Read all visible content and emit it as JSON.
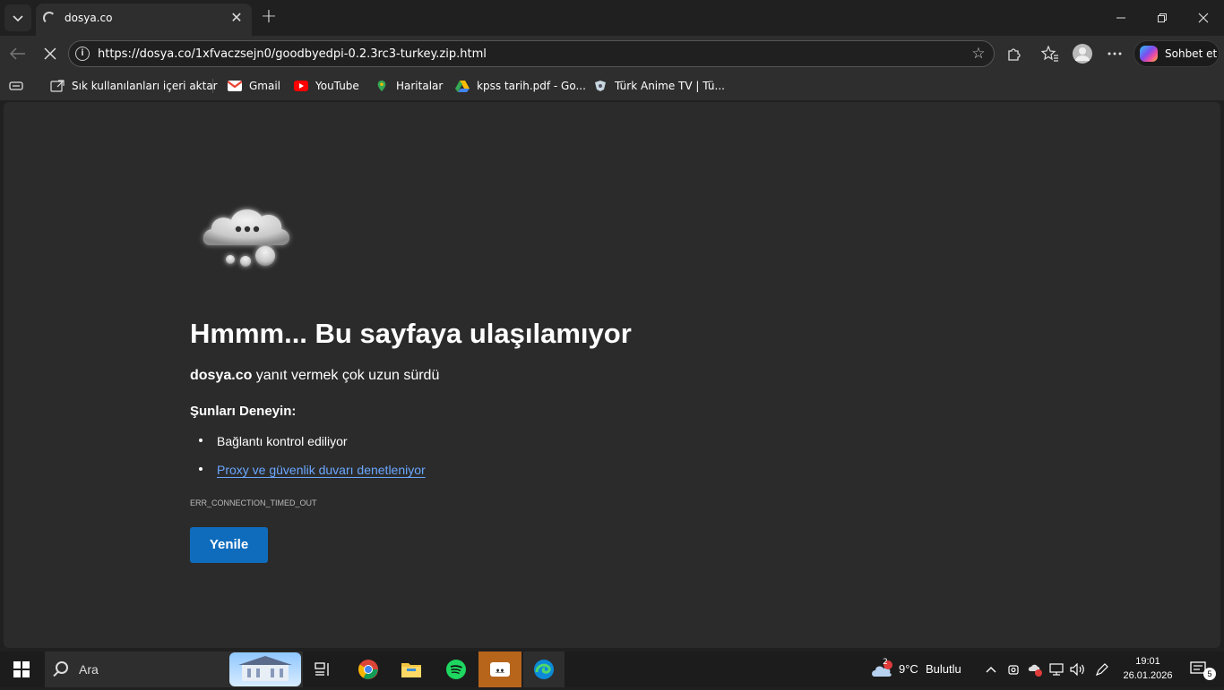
{
  "tab": {
    "title": "dosya.co",
    "close_glyph": "✕"
  },
  "new_tab_glyph": "+",
  "window": {
    "minimize": "—",
    "maximize": "⧉",
    "close": "✕"
  },
  "address": {
    "url": "https://dosya.co/1xfvaczsejn0/goodbyedpi-0.2.3rc3-turkey.zip.html",
    "info_glyph": "i"
  },
  "copilot": {
    "label": "Sohbet et"
  },
  "bookmarks": [
    {
      "label": "Sık kullanılanları içeri aktar",
      "icon": "import-icon"
    },
    {
      "label": "Gmail",
      "icon": "gmail-icon"
    },
    {
      "label": "YouTube",
      "icon": "youtube-icon"
    },
    {
      "label": "Haritalar",
      "icon": "maps-icon"
    },
    {
      "label": "kpss tarih.pdf - Go...",
      "icon": "drive-icon"
    },
    {
      "label": "Türk Anime TV | Tü...",
      "icon": "turkanime-icon"
    }
  ],
  "error": {
    "title": "Hmmm... Bu sayfaya ulaşılamıyor",
    "host": "dosya.co",
    "message": " yanıt vermek çok uzun sürdü",
    "try_heading": "Şunları Deneyin:",
    "suggestions": [
      {
        "text": "Bağlantı kontrol ediliyor",
        "link": false
      },
      {
        "text": "Proxy ve güvenlik duvarı denetleniyor",
        "link": true
      }
    ],
    "code": "ERR_CONNECTION_TIMED_OUT",
    "reload_label": "Yenile"
  },
  "taskbar": {
    "search_label": "Ara",
    "weather_temp": "9°C",
    "weather_desc": "Bulutlu",
    "weather_badge": "2",
    "time": "19:01",
    "date": "26.01.2026",
    "notification_count": "5"
  },
  "colors": {
    "accent": "#0f6cbd",
    "link": "#6aa7ff",
    "content_bg": "#2b2b2b",
    "chrome_bg": "#2e2e2e"
  }
}
